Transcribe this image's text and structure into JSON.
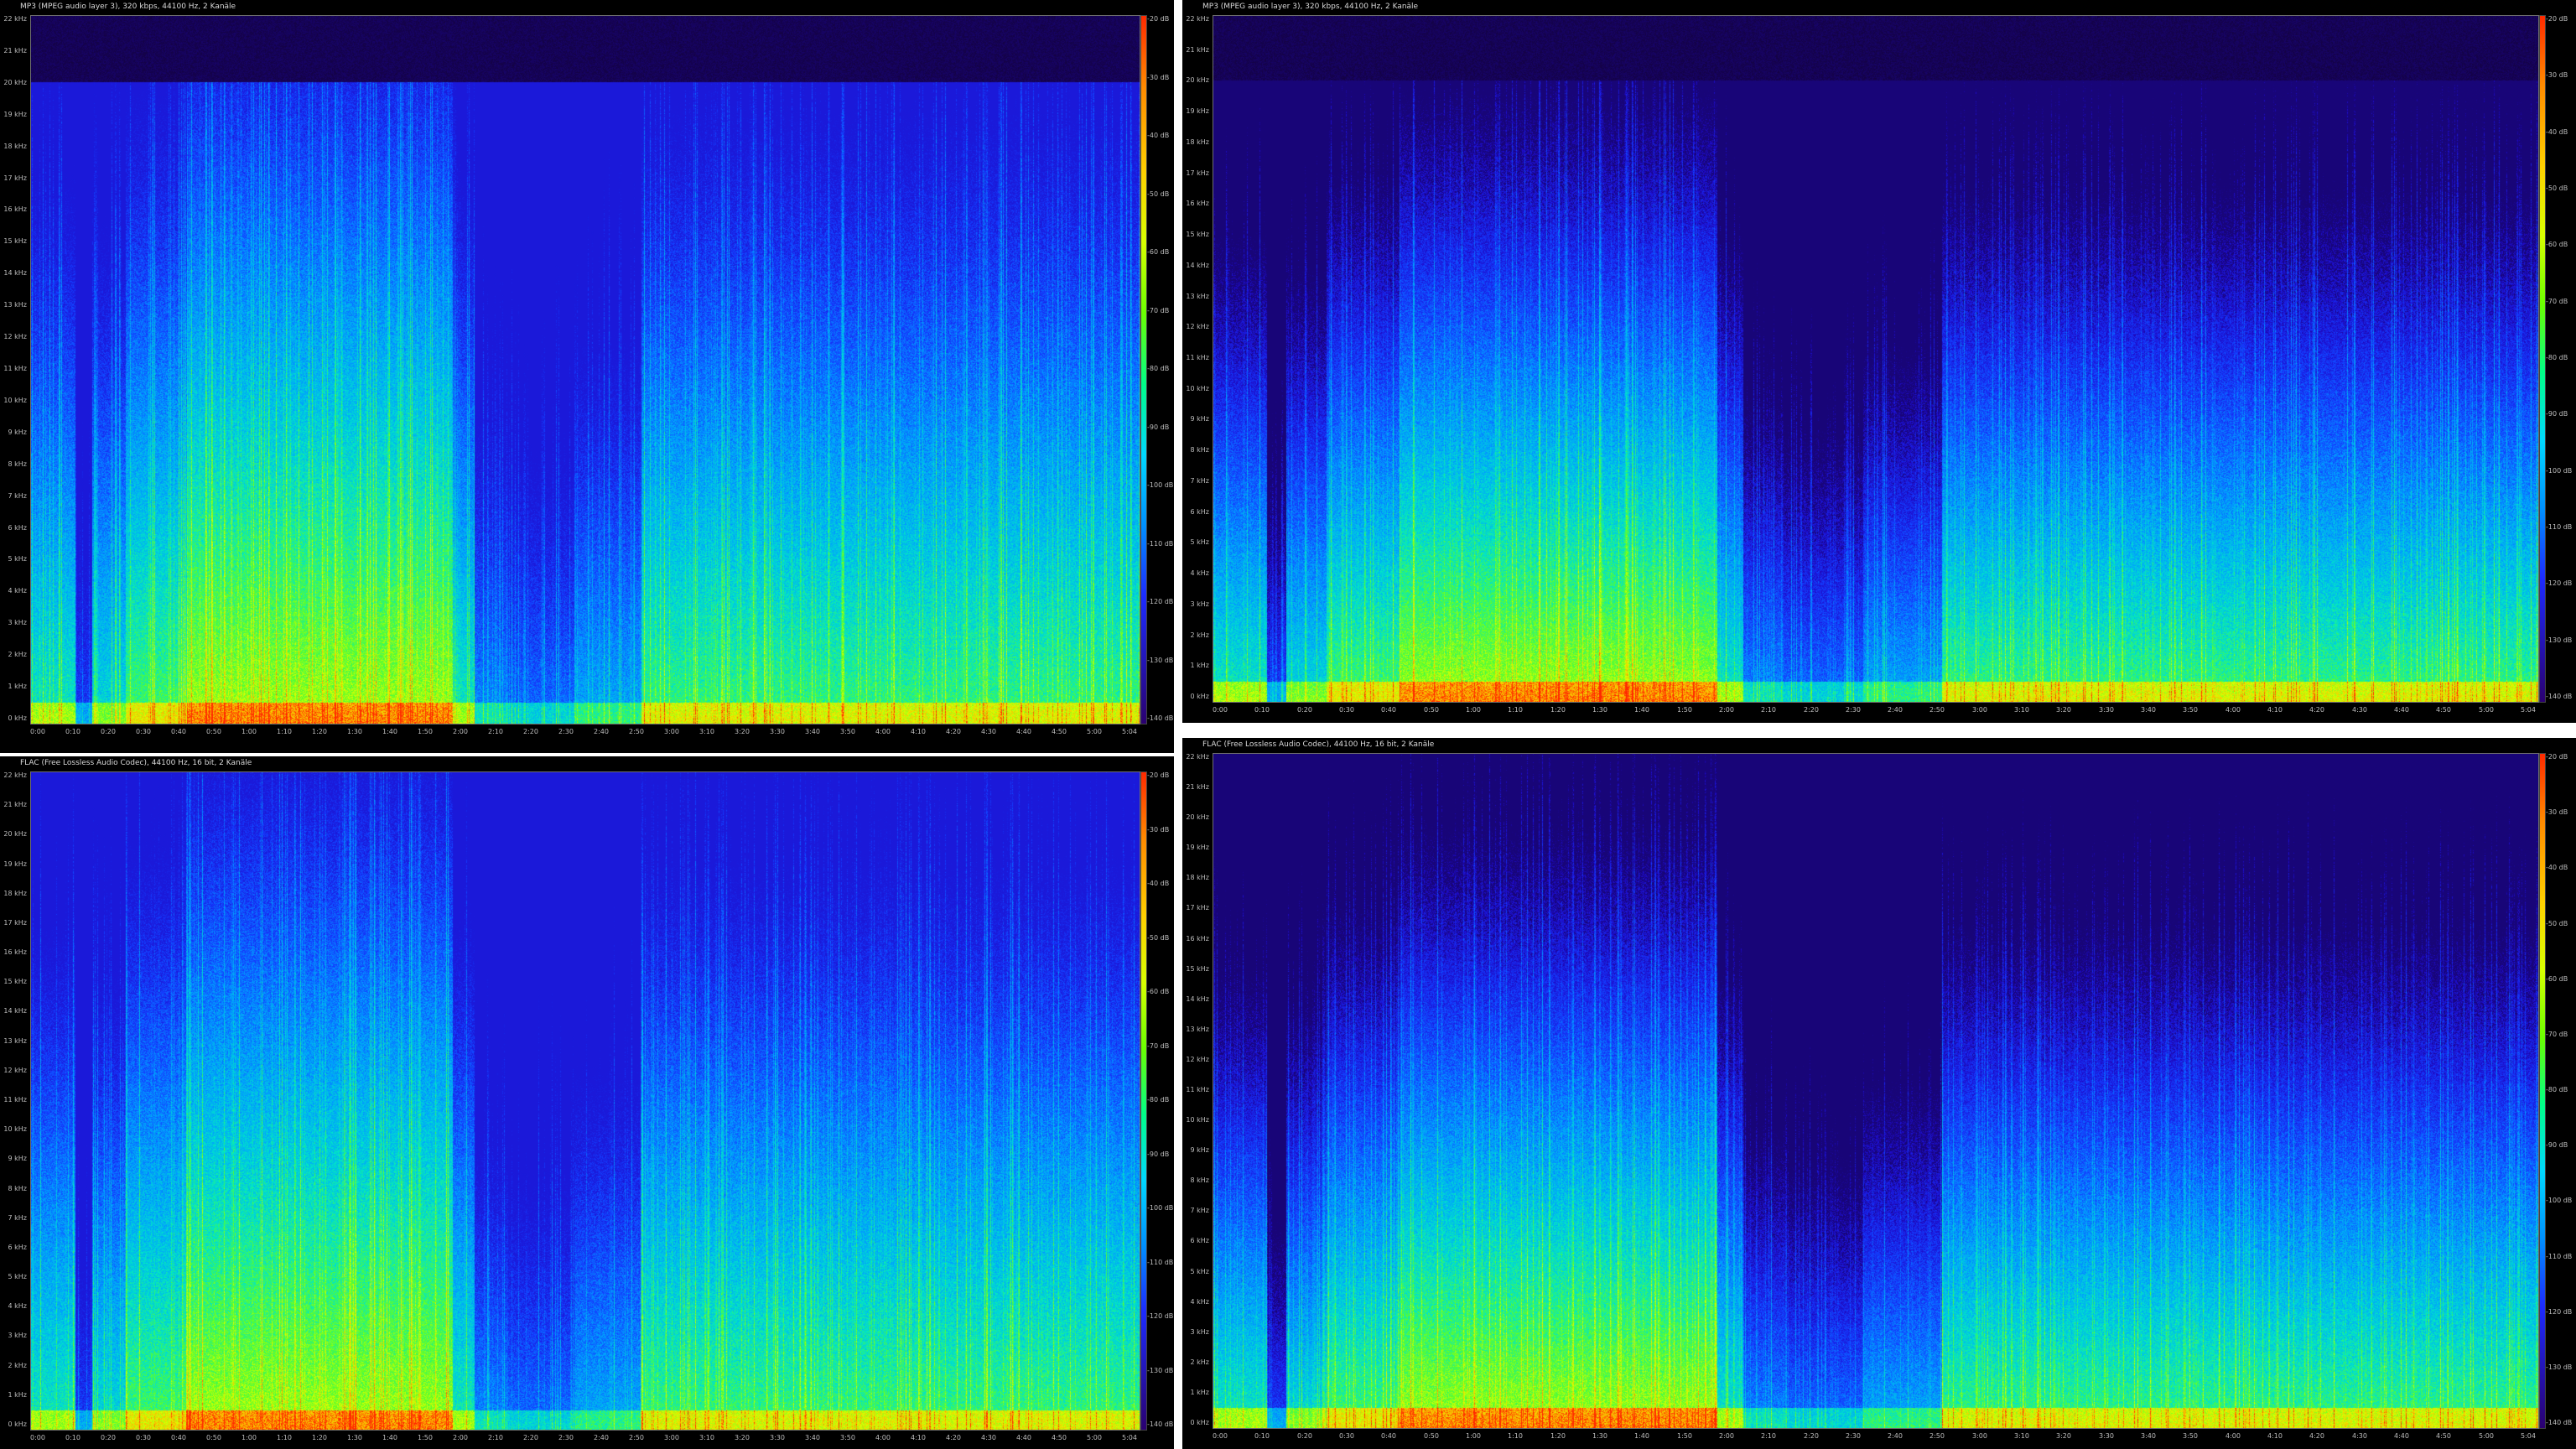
{
  "screenshot": {
    "panels": [
      {
        "id": "tl",
        "title": "MP3 (MPEG audio layer 3), 320 kbps, 44100 Hz, 2 Kanäle",
        "cutoff_hz": 20000,
        "y_labels": [
          "22 kHz",
          "21 kHz",
          "20 kHz",
          "19 kHz",
          "18 kHz",
          "17 kHz",
          "16 kHz",
          "15 kHz",
          "14 kHz",
          "13 kHz",
          "12 kHz",
          "11 kHz",
          "10 kHz",
          "9 kHz",
          "8 kHz",
          "7 kHz",
          "6 kHz",
          "5 kHz",
          "4 kHz",
          "3 kHz",
          "2 kHz",
          "1 kHz",
          "0 kHz"
        ],
        "x_labels": [
          "0:00",
          "0:10",
          "0:20",
          "0:30",
          "0:40",
          "0:50",
          "1:00",
          "1:10",
          "1:20",
          "1:30",
          "1:40",
          "1:50",
          "2:00",
          "2:10",
          "2:20",
          "2:30",
          "2:40",
          "2:50",
          "3:00",
          "3:10",
          "3:20",
          "3:30",
          "3:40",
          "3:50",
          "4:00",
          "4:10",
          "4:20",
          "4:30",
          "4:40",
          "4:50",
          "5:00",
          "5:04"
        ],
        "db_labels": [
          "-20 dB",
          "-30 dB",
          "-40 dB",
          "-50 dB",
          "-60 dB",
          "-70 dB",
          "-80 dB",
          "-90 dB",
          "-100 dB",
          "-110 dB",
          "-120 dB",
          "-130 dB",
          "-140 dB"
        ]
      },
      {
        "id": "tr",
        "title": "MP3 (MPEG audio layer 3), 320 kbps, 44100 Hz, 2 Kanäle",
        "cutoff_hz": 20000,
        "y_labels": [
          "22 kHz",
          "21 kHz",
          "20 kHz",
          "19 kHz",
          "18 kHz",
          "17 kHz",
          "16 kHz",
          "15 kHz",
          "14 kHz",
          "13 kHz",
          "12 kHz",
          "11 kHz",
          "10 kHz",
          "9 kHz",
          "8 kHz",
          "7 kHz",
          "6 kHz",
          "5 kHz",
          "4 kHz",
          "3 kHz",
          "2 kHz",
          "1 kHz",
          "0 kHz"
        ],
        "x_labels": [
          "0:00",
          "0:10",
          "0:20",
          "0:30",
          "0:40",
          "0:50",
          "1:00",
          "1:10",
          "1:20",
          "1:30",
          "1:40",
          "1:50",
          "2:00",
          "2:10",
          "2:20",
          "2:30",
          "2:40",
          "2:50",
          "3:00",
          "3:10",
          "3:20",
          "3:30",
          "3:40",
          "3:50",
          "4:00",
          "4:10",
          "4:20",
          "4:30",
          "4:40",
          "4:50",
          "5:00",
          "5:04"
        ],
        "db_labels": [
          "-20 dB",
          "-30 dB",
          "-40 dB",
          "-50 dB",
          "-60 dB",
          "-70 dB",
          "-80 dB",
          "-90 dB",
          "-100 dB",
          "-110 dB",
          "-120 dB",
          "-130 dB",
          "-140 dB"
        ]
      },
      {
        "id": "bl",
        "title": "FLAC (Free Lossless Audio Codec), 44100 Hz, 16 bit, 2 Kanäle",
        "cutoff_hz": 22050,
        "y_labels": [
          "22 kHz",
          "21 kHz",
          "20 kHz",
          "19 kHz",
          "18 kHz",
          "17 kHz",
          "16 kHz",
          "15 kHz",
          "14 kHz",
          "13 kHz",
          "12 kHz",
          "11 kHz",
          "10 kHz",
          "9 kHz",
          "8 kHz",
          "7 kHz",
          "6 kHz",
          "5 kHz",
          "4 kHz",
          "3 kHz",
          "2 kHz",
          "1 kHz",
          "0 kHz"
        ],
        "x_labels": [
          "0:00",
          "0:10",
          "0:20",
          "0:30",
          "0:40",
          "0:50",
          "1:00",
          "1:10",
          "1:20",
          "1:30",
          "1:40",
          "1:50",
          "2:00",
          "2:10",
          "2:20",
          "2:30",
          "2:40",
          "2:50",
          "3:00",
          "3:10",
          "3:20",
          "3:30",
          "3:40",
          "3:50",
          "4:00",
          "4:10",
          "4:20",
          "4:30",
          "4:40",
          "4:50",
          "5:00",
          "5:04"
        ],
        "db_labels": [
          "-20 dB",
          "-30 dB",
          "-40 dB",
          "-50 dB",
          "-60 dB",
          "-70 dB",
          "-80 dB",
          "-90 dB",
          "-100 dB",
          "-110 dB",
          "-120 dB",
          "-130 dB",
          "-140 dB"
        ]
      },
      {
        "id": "br",
        "title": "FLAC (Free Lossless Audio Codec), 44100 Hz, 16 bit, 2 Kanäle",
        "cutoff_hz": 22050,
        "y_labels": [
          "22 kHz",
          "21 kHz",
          "20 kHz",
          "19 kHz",
          "18 kHz",
          "17 kHz",
          "16 kHz",
          "15 kHz",
          "14 kHz",
          "13 kHz",
          "12 kHz",
          "11 kHz",
          "10 kHz",
          "9 kHz",
          "8 kHz",
          "7 kHz",
          "6 kHz",
          "5 kHz",
          "4 kHz",
          "3 kHz",
          "2 kHz",
          "1 kHz",
          "0 kHz"
        ],
        "x_labels": [
          "0:00",
          "0:10",
          "0:20",
          "0:30",
          "0:40",
          "0:50",
          "1:00",
          "1:10",
          "1:20",
          "1:30",
          "1:40",
          "1:50",
          "2:00",
          "2:10",
          "2:20",
          "2:30",
          "2:40",
          "2:50",
          "3:00",
          "3:10",
          "3:20",
          "3:30",
          "3:40",
          "3:50",
          "4:00",
          "4:10",
          "4:20",
          "4:30",
          "4:40",
          "4:50",
          "5:00",
          "5:04"
        ],
        "db_labels": [
          "-20 dB",
          "-30 dB",
          "-40 dB",
          "-50 dB",
          "-60 dB",
          "-70 dB",
          "-80 dB",
          "-90 dB",
          "-100 dB",
          "-110 dB",
          "-120 dB",
          "-130 dB",
          "-140 dB"
        ]
      }
    ],
    "colors": {
      "background": "#000000",
      "divider": "#ffffff",
      "hot": "#ff2a00",
      "warm": "#ffd000",
      "mid": "#6cff00",
      "cool": "#00d8ff",
      "cold": "#1d2bff",
      "floor": "#120020"
    }
  }
}
